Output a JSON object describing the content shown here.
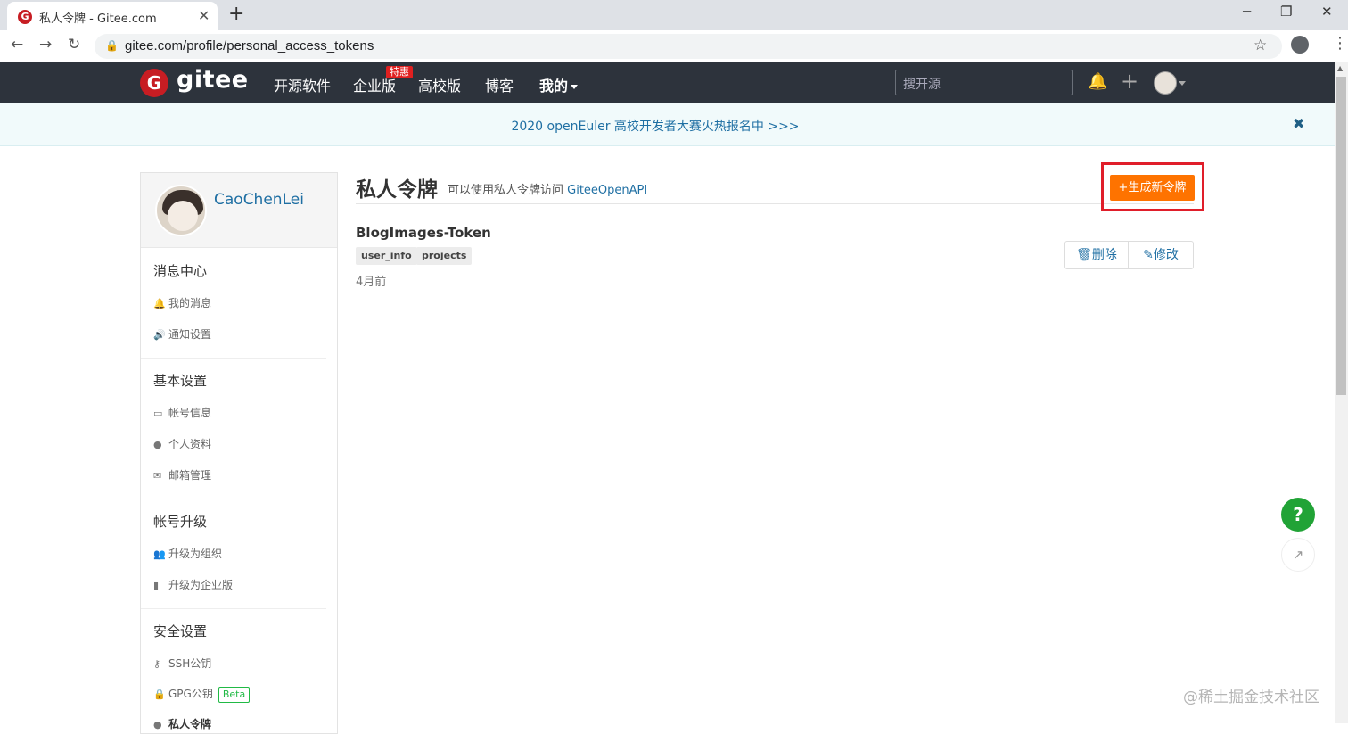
{
  "browser": {
    "tab_title": "私人令牌 - Gitee.com",
    "url": "gitee.com/profile/personal_access_tokens"
  },
  "topnav": {
    "logo_letter": "G",
    "logo_text": "gitee",
    "items": [
      "开源软件",
      "企业版",
      "高校版",
      "博客",
      "我的"
    ],
    "hot_badge": "特惠",
    "search_placeholder": "搜开源"
  },
  "banner": {
    "text": "2020 openEuler 高校开发者大赛火热报名中 >>>",
    "close": "✖"
  },
  "sidebar": {
    "username": "CaoChenLei",
    "sections": [
      {
        "title": "消息中心",
        "items": [
          {
            "icon": "bell-icon",
            "label": "我的消息"
          },
          {
            "icon": "speaker-icon",
            "label": "通知设置"
          }
        ]
      },
      {
        "title": "基本设置",
        "items": [
          {
            "icon": "id-card-icon",
            "label": "帐号信息"
          },
          {
            "icon": "user-icon",
            "label": "个人资料"
          },
          {
            "icon": "mail-icon",
            "label": "邮箱管理"
          }
        ]
      },
      {
        "title": "帐号升级",
        "items": [
          {
            "icon": "group-icon",
            "label": "升级为组织"
          },
          {
            "icon": "building-icon",
            "label": "升级为企业版"
          }
        ]
      },
      {
        "title": "安全设置",
        "items": [
          {
            "icon": "key-icon",
            "label": "SSH公钥"
          },
          {
            "icon": "lock-icon",
            "label": "GPG公钥",
            "badge": "Beta"
          },
          {
            "icon": "user-icon",
            "label": "私人令牌"
          }
        ]
      }
    ]
  },
  "main": {
    "title": "私人令牌",
    "subtitle_prefix": "可以使用私人令牌访问 ",
    "subtitle_link": "GiteeOpenAPI",
    "generate_button": "+生成新令牌",
    "token": {
      "name": "BlogImages-Token",
      "scopes": [
        "user_info",
        "projects"
      ],
      "age": "4月前",
      "delete_label": "删除",
      "edit_label": "修改"
    }
  },
  "floating": {
    "help": "?"
  },
  "watermark": "@稀土掘金技术社区",
  "colors": {
    "brand": "#c71d23",
    "accent_orange": "#fe7300",
    "link": "#1f6fa3",
    "highlight": "#e01e2a",
    "help_green": "#21a336"
  }
}
